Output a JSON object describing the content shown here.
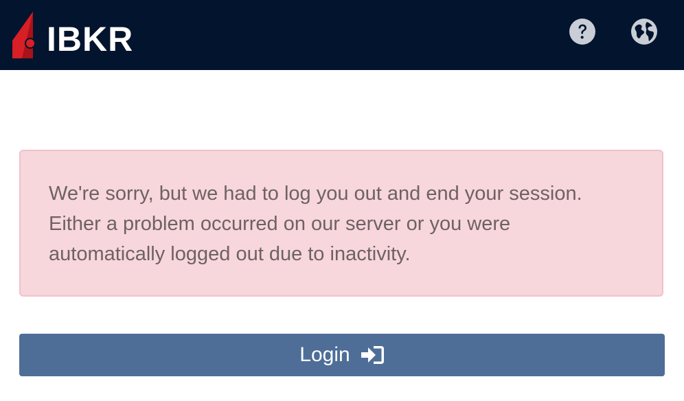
{
  "header": {
    "brand": "IBKR",
    "background": "#03142e",
    "brand_accent": "#d81f26",
    "icons": [
      "help-icon",
      "globe-icon"
    ]
  },
  "alert": {
    "lines": [
      "We're sorry, but we had to log you out and end your session.",
      "Either a problem occurred on our server or you were",
      "automatically logged out due to inactivity."
    ],
    "background": "#f7d6dc",
    "text_color": "#6e6263"
  },
  "login_button": {
    "label": "Login",
    "icon": "sign-in-icon",
    "background": "#4e6e98"
  }
}
